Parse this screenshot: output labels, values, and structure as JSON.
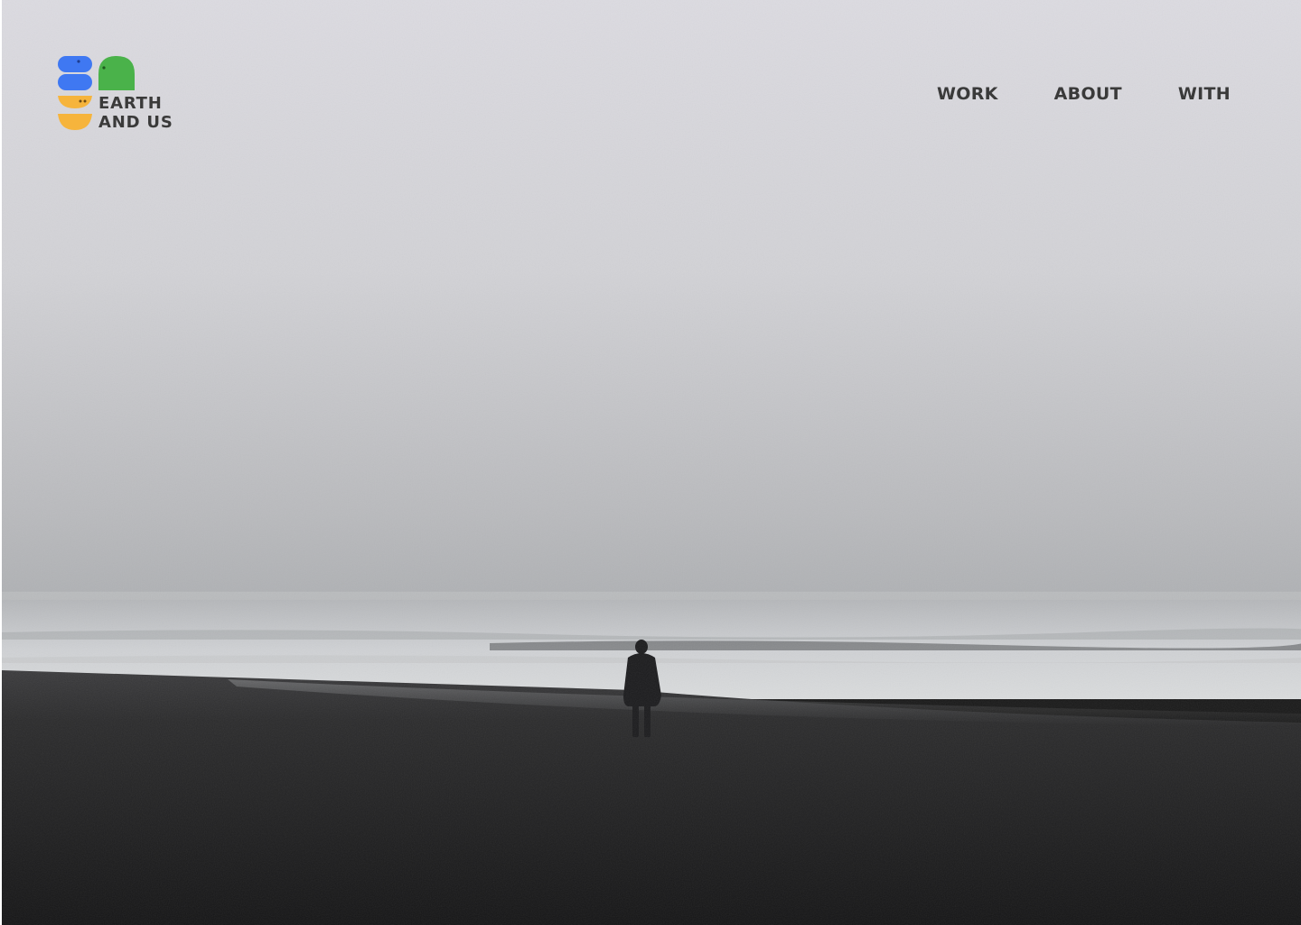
{
  "brand": {
    "line1": "EARTH",
    "line2": "AND US",
    "colors": {
      "blue": "#3f78f2",
      "green": "#4ab24a",
      "yellow": "#f6b43c",
      "text": "#3a3a3a"
    }
  },
  "nav": {
    "items": [
      {
        "label": "WORK"
      },
      {
        "label": "ABOUT"
      },
      {
        "label": "WITH"
      }
    ]
  },
  "hero": {
    "image": "misty beach with lone figure"
  }
}
